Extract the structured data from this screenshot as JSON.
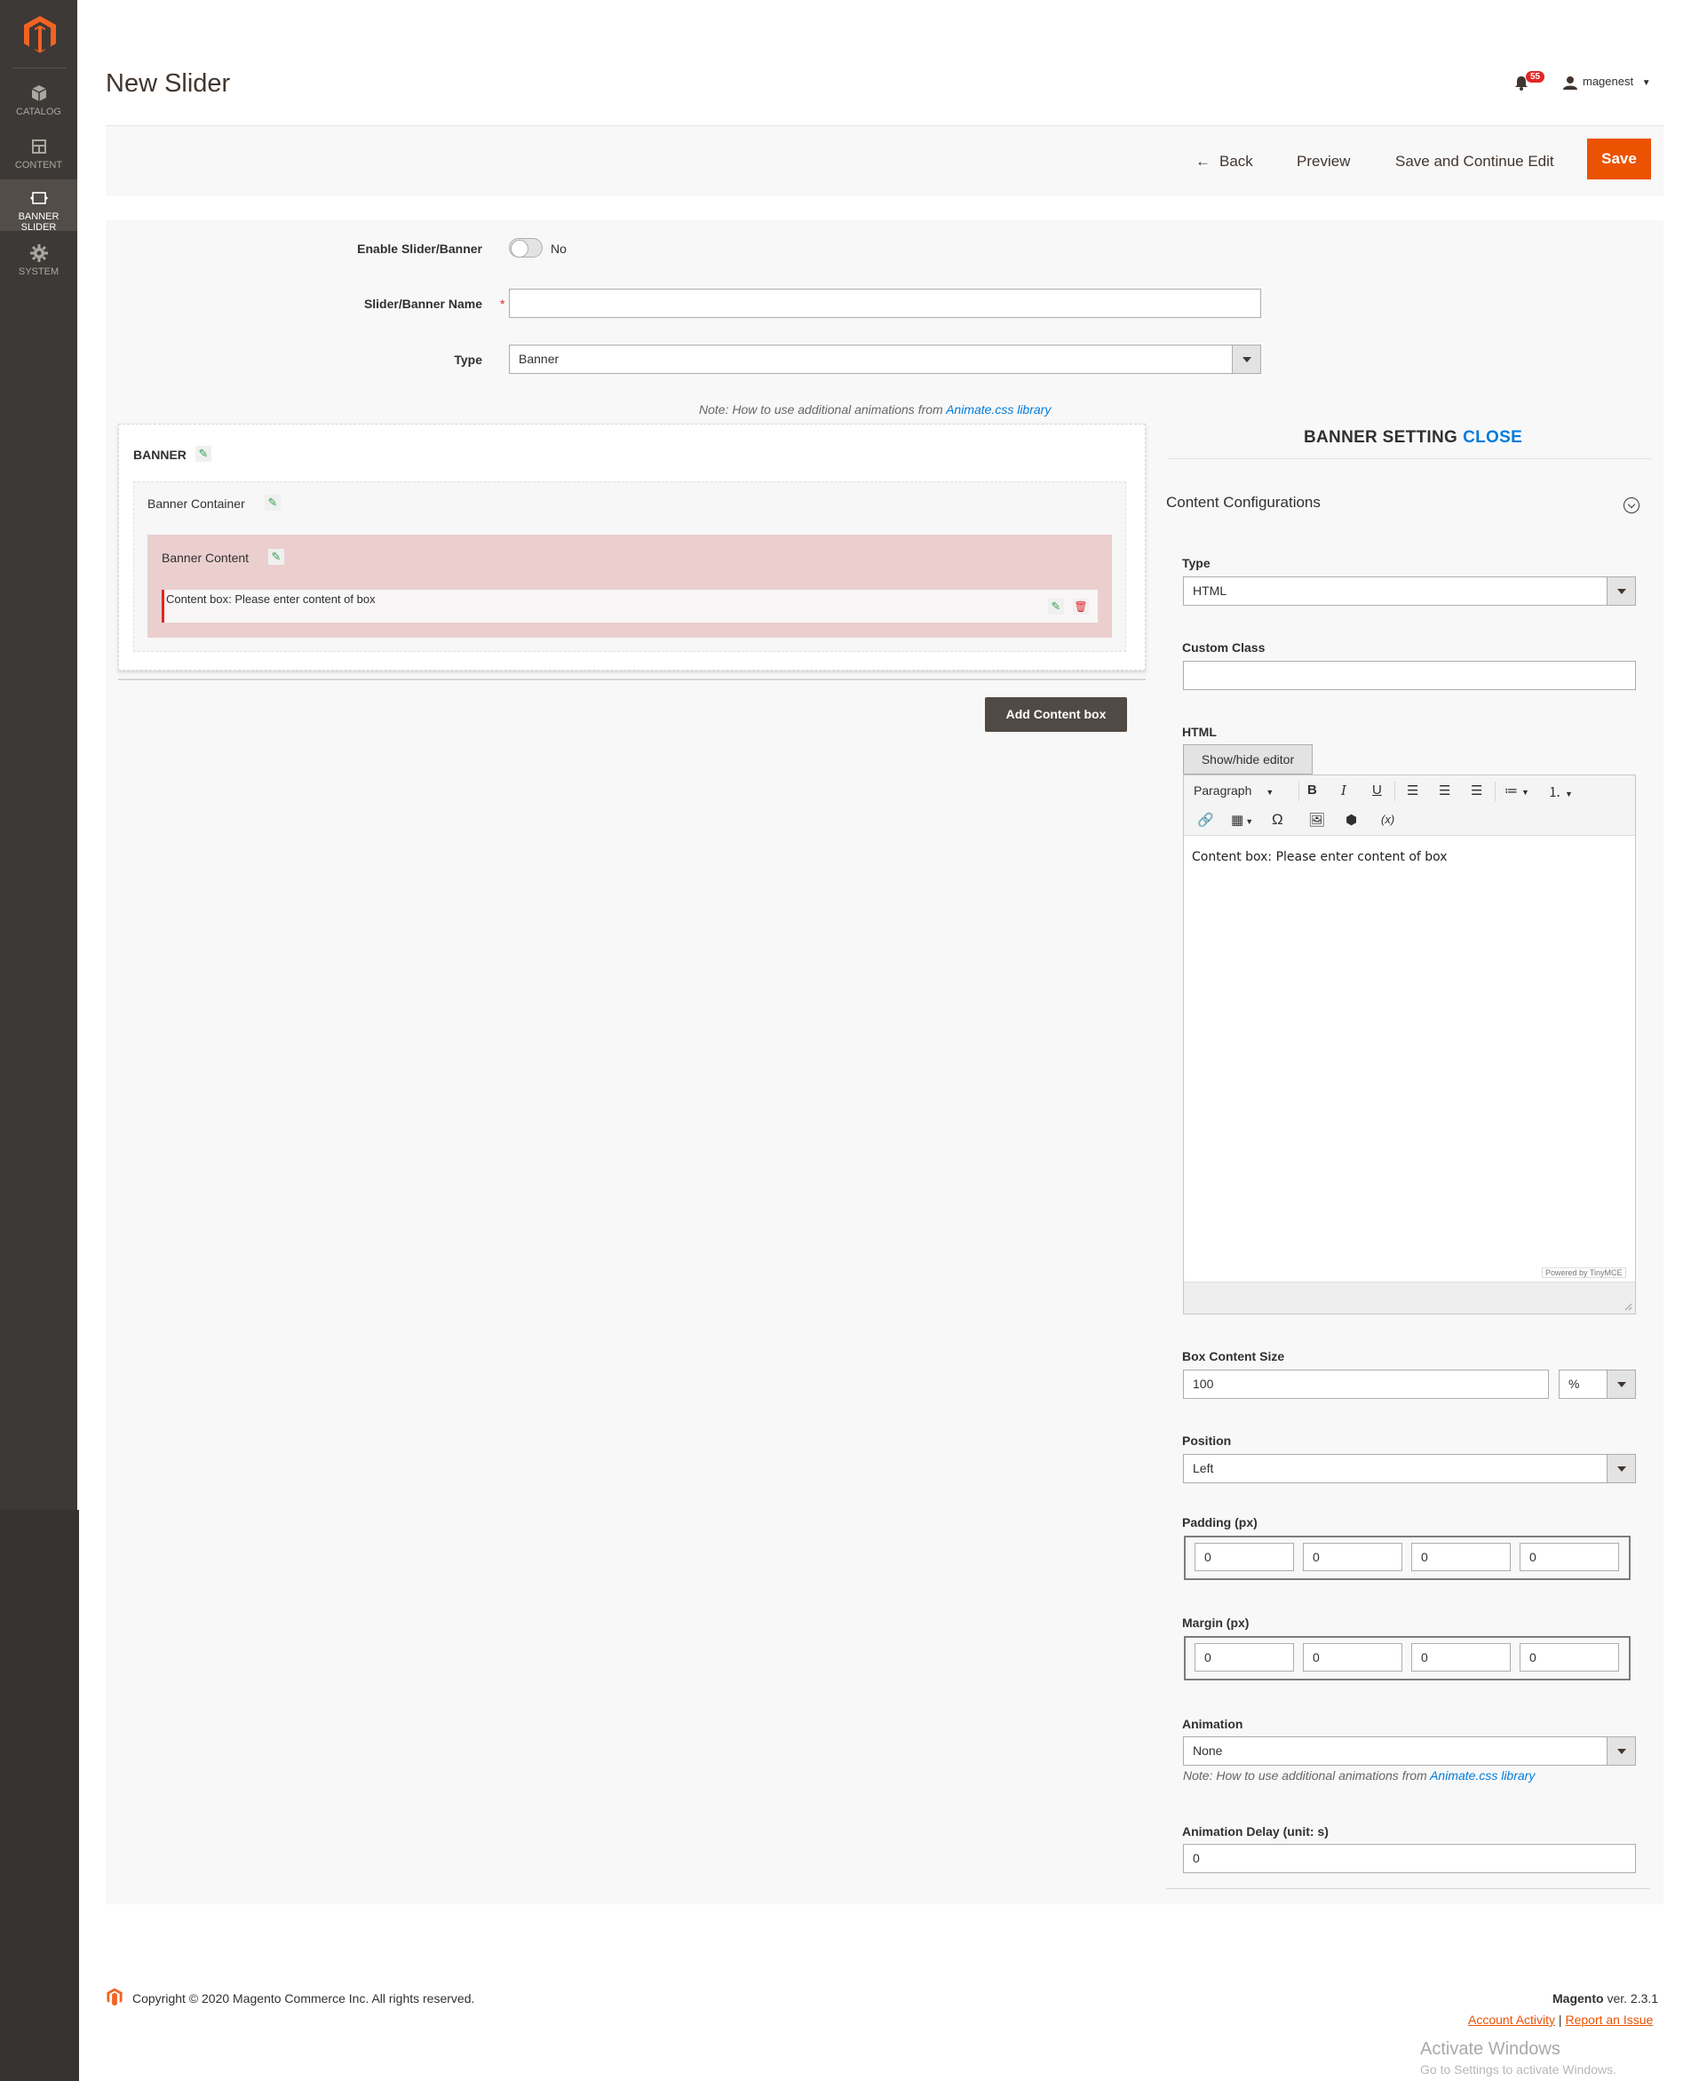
{
  "sidebar": {
    "items": [
      {
        "label": "CATALOG",
        "icon": "box-icon"
      },
      {
        "label": "CONTENT",
        "icon": "layout-icon"
      },
      {
        "label": "BANNER SLIDER",
        "icon": "slider-icon"
      },
      {
        "label": "SYSTEM",
        "icon": "gear-icon"
      }
    ],
    "active": "BANNER SLIDER"
  },
  "header": {
    "title": "New Slider",
    "notifications_count": "55",
    "user": "magenest"
  },
  "actions": {
    "back": "Back",
    "preview": "Preview",
    "save_continue": "Save and Continue Edit",
    "save": "Save"
  },
  "form": {
    "enable_label": "Enable Slider/Banner",
    "enable_value": "No",
    "name_label": "Slider/Banner Name",
    "name_value": "",
    "type_label": "Type",
    "type_value": "Banner",
    "note_prefix": "Note: How to use additional animations from ",
    "note_link": "Animate.css library"
  },
  "builder": {
    "banner_title": "BANNER",
    "container_title": "Banner Container",
    "content_title": "Banner Content",
    "content_box_text": "Content box: Please enter content of box",
    "add_button": "Add Content box"
  },
  "settings": {
    "title": "BANNER SETTING",
    "close": "CLOSE",
    "section": "Content Configurations",
    "type_label": "Type",
    "type_value": "HTML",
    "custom_class_label": "Custom Class",
    "custom_class_value": "",
    "html_label": "HTML",
    "show_hide": "Show/hide editor",
    "editor": {
      "paragraph": "Paragraph",
      "content": "Content box: Please enter content of box",
      "powered": "Powered by TinyMCE"
    },
    "box_size_label": "Box Content Size",
    "box_size_value": "100",
    "box_size_unit": "%",
    "position_label": "Position",
    "position_value": "Left",
    "padding_label": "Padding (px)",
    "padding": [
      "0",
      "0",
      "0",
      "0"
    ],
    "margin_label": "Margin (px)",
    "margin": [
      "0",
      "0",
      "0",
      "0"
    ],
    "animation_label": "Animation",
    "animation_value": "None",
    "animation_note_prefix": "Note: How to use additional animations from ",
    "animation_note_link": "Animate.css library",
    "delay_label": "Animation Delay (unit: s)",
    "delay_value": "0"
  },
  "footer": {
    "copyright": "Copyright © 2020 Magento Commerce Inc. All rights reserved.",
    "brand": "Magento",
    "version": " ver. 2.3.1",
    "account_activity": "Account Activity",
    "separator": " | ",
    "report_issue": "Report an Issue"
  },
  "overlay": {
    "activate_title": "Activate Windows",
    "activate_sub": "Go to Settings to activate Windows."
  }
}
